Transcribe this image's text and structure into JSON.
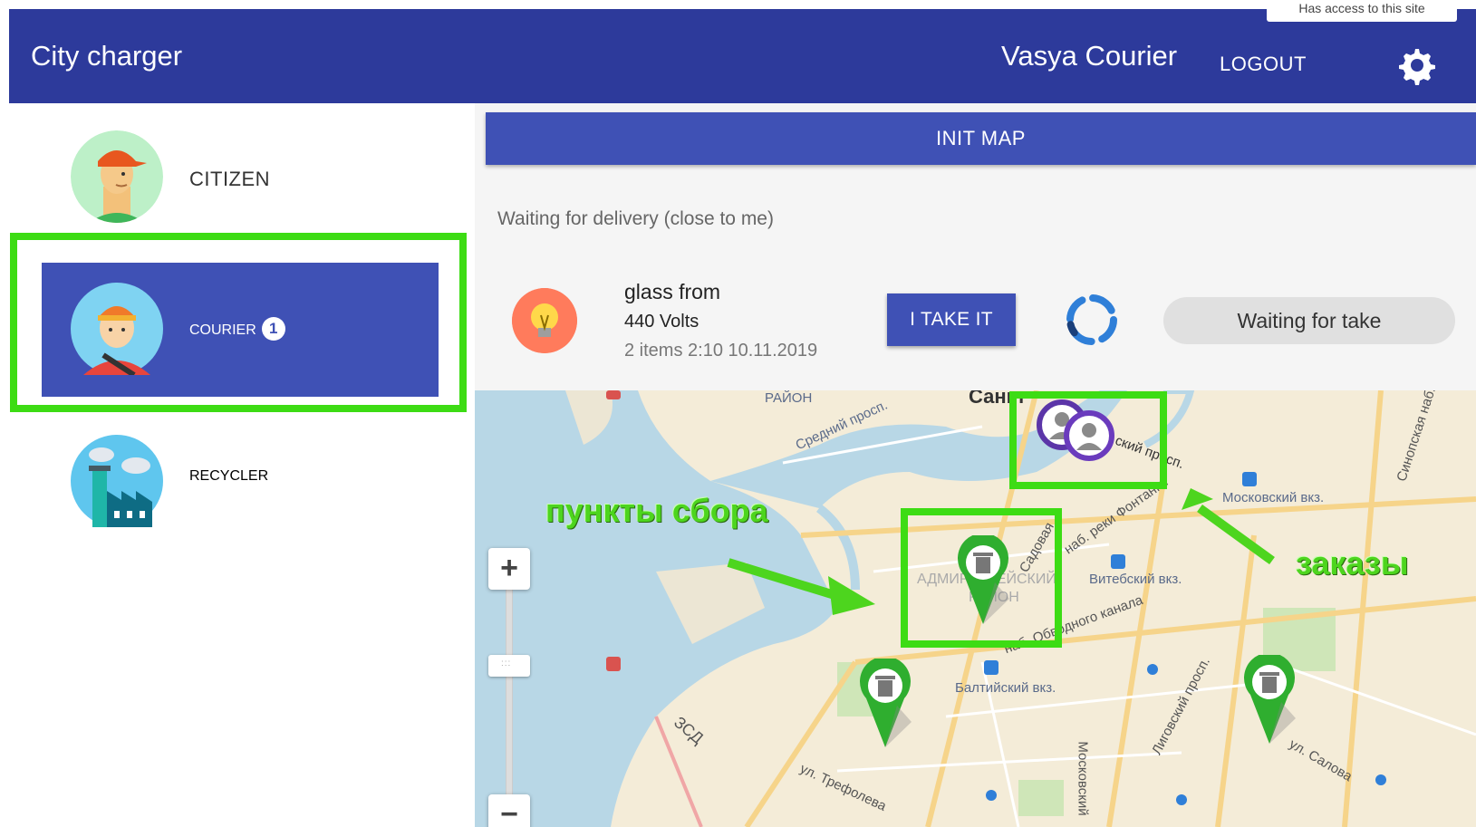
{
  "header": {
    "app_title": "City charger",
    "user_name": "Vasya Courier",
    "logout_label": "LOGOUT",
    "access_tooltip": "Has access to this site"
  },
  "sidebar": {
    "roles": [
      {
        "label": "CITIZEN"
      },
      {
        "label": "COURIER",
        "badge": "1",
        "selected": true
      },
      {
        "label": "RECYCLER"
      }
    ]
  },
  "main": {
    "init_map_label": "INIT MAP",
    "section_title": "Waiting for delivery (close to me)",
    "order": {
      "title": "glass from",
      "source": "440 Volts",
      "meta": "2 items 2:10 10.11.2019",
      "take_label": "I TAKE IT",
      "status": "Waiting for take"
    }
  },
  "map": {
    "labels": {
      "district_top": "РАЙОН",
      "sredniy": "Средний просп.",
      "sankt": "Санкт",
      "prosp_top": "ский просп.",
      "moskovsky_vkz": "Московский вкз.",
      "vitebsky_vkz": "Витебский вкз.",
      "baltiysky_vkz": "Балтийский вкз.",
      "admiralteysky": "АДМИРАЛТЕЙСКИЙ",
      "rayon": "РАЙОН",
      "obvodny": "наб. Обводного канала",
      "ligovsky": "Лиговский просп.",
      "zsd": "ЗСД",
      "trefoleva": "ул. Трефолева",
      "salova": "ул. Салова",
      "moskovsky_pr": "Московский",
      "reki_fontanki": "наб. реки Фонтанки",
      "sinopskaya": "Синопская наб.",
      "sadovaya": "Садовая"
    },
    "annotations": {
      "collection_points": "пункты сбора",
      "orders": "заказы"
    },
    "zoom_in": "+",
    "zoom_out": "−"
  },
  "colors": {
    "header_bg": "#2d3a9b",
    "primary": "#3f51b5",
    "highlight": "#3ddc14",
    "pin_green": "#2fae2f",
    "marker_purple": "#6a3bbd"
  }
}
